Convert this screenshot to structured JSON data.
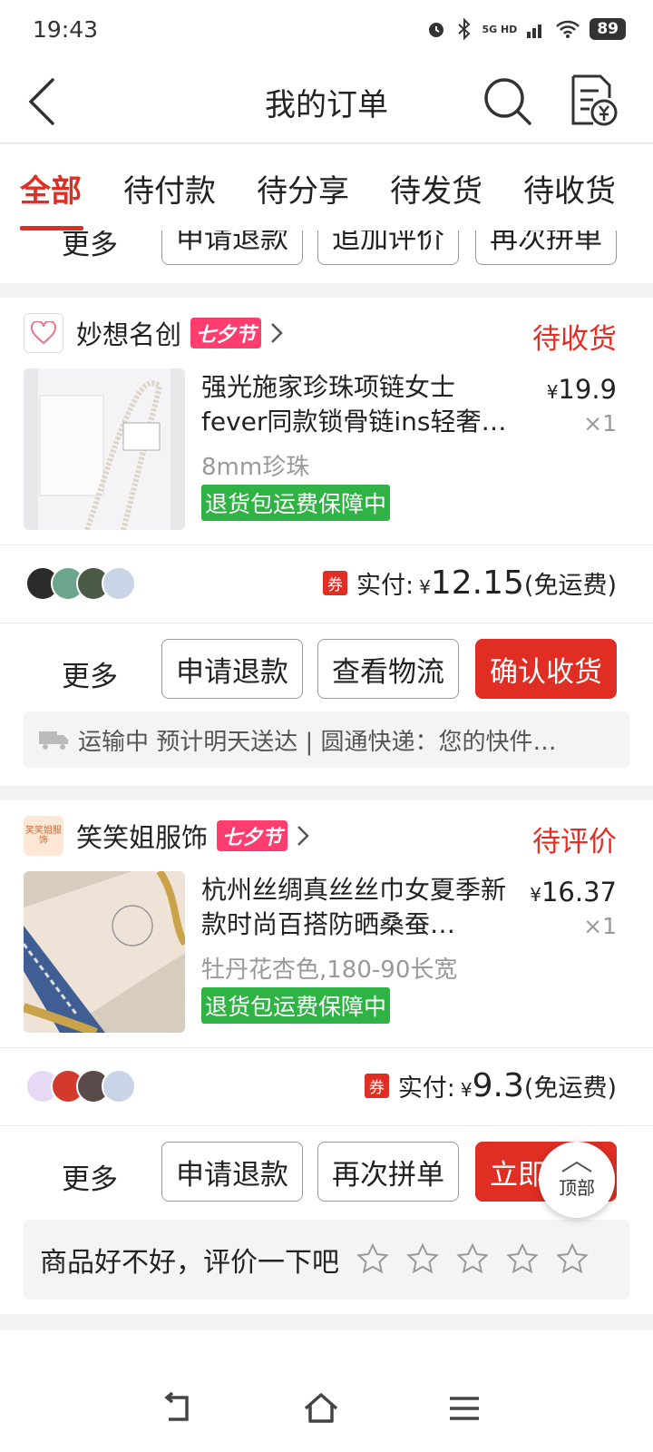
{
  "status_bar": {
    "time": "19:43",
    "battery": "89",
    "network": "5G HD"
  },
  "header": {
    "title": "我的订单"
  },
  "tabs": [
    {
      "label": "全部",
      "active": true
    },
    {
      "label": "待付款"
    },
    {
      "label": "待分享"
    },
    {
      "label": "待发货"
    },
    {
      "label": "待收货"
    }
  ],
  "prev_order_buttons": {
    "more": "更多",
    "b1": "申请退款",
    "b2": "追加评价",
    "b3": "再次拼单"
  },
  "orders": [
    {
      "shop": "妙想名创",
      "badge": "七夕节",
      "status": "待收货",
      "title": "强光施家珍珠项链女士fever同款锁骨链ins轻奢…",
      "price_symbol": "¥",
      "price": "19.9",
      "qty": "×1",
      "spec": "8mm珍珠",
      "guarantee": "退货包运费保障中",
      "coupon": "券",
      "paid_label": "实付:",
      "paid_symbol": "¥",
      "paid": "12.15",
      "shipping": "(免运费)",
      "buttons": {
        "more": "更多",
        "b1": "申请退款",
        "b2": "查看物流",
        "b3": "确认收货"
      },
      "logistics": "运输中 预计明天送达 | 圆通快递：您的快件…"
    },
    {
      "shop": "笑笑姐服饰",
      "logo_text": "笑笑姐服饰",
      "badge": "七夕节",
      "status": "待评价",
      "title": "杭州丝绸真丝丝巾女夏季新款时尚百搭防晒桑蚕…",
      "price_symbol": "¥",
      "price": "16.37",
      "qty": "×1",
      "spec": "牡丹花杏色,180-90长宽",
      "guarantee": "退货包运费保障中",
      "coupon": "券",
      "paid_label": "实付:",
      "paid_symbol": "¥",
      "paid": "9.3",
      "shipping": "(免运费)",
      "buttons": {
        "more": "更多",
        "b1": "申请退款",
        "b2": "再次拼单",
        "b3": "立即评价"
      },
      "review_prompt": "商品好不好，评价一下吧",
      "star_rating": 0
    }
  ],
  "top_button": "顶部",
  "colors": {
    "accent": "#e02e24",
    "badge": "#ff3d6e",
    "guarantee": "#2fb344"
  }
}
